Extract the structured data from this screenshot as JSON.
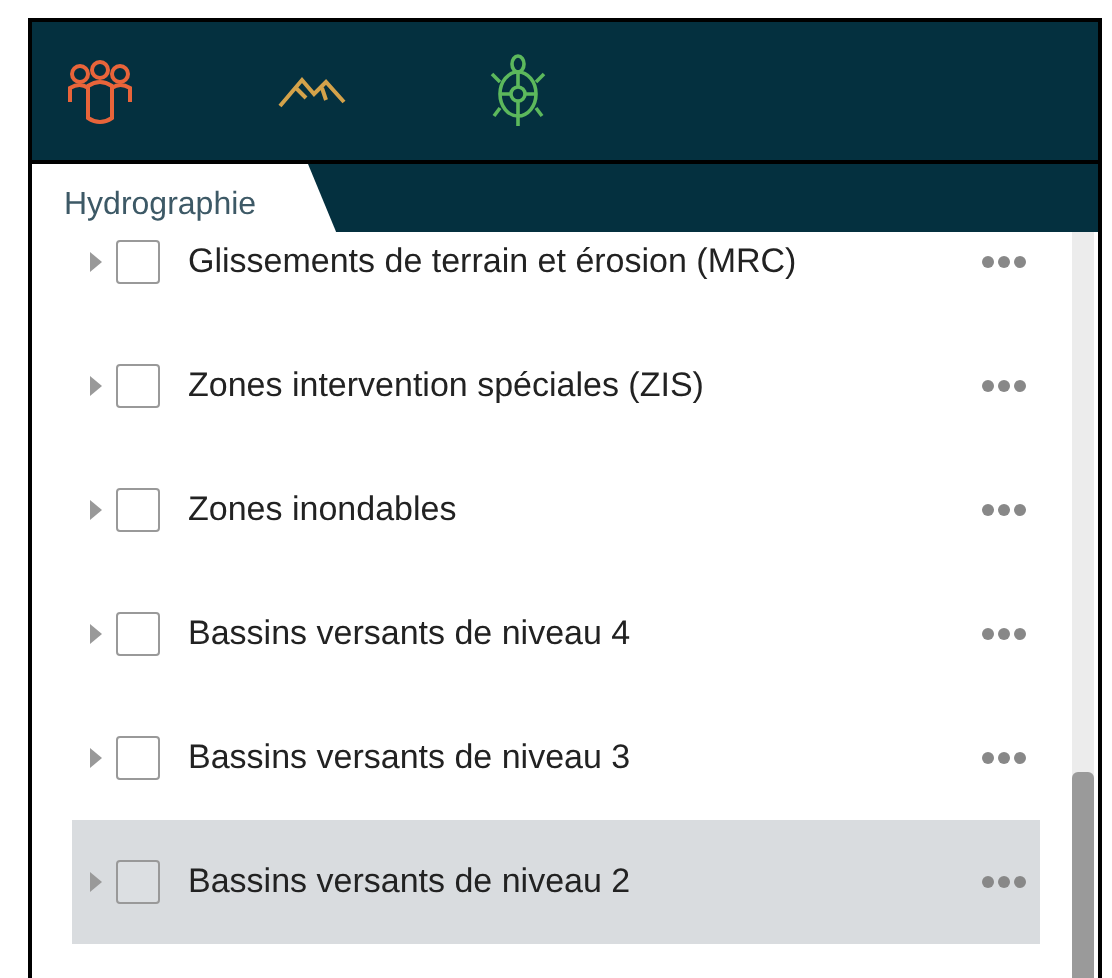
{
  "toolbar": {
    "icons": [
      {
        "kind": "people",
        "color": "#e8643a"
      },
      {
        "kind": "mountains",
        "color": "#d4a24a"
      },
      {
        "kind": "turtle",
        "color": "#5cb85c"
      }
    ]
  },
  "tabs": [
    {
      "label": "Hydrographie",
      "selected": true
    }
  ],
  "layers": [
    {
      "name": "Glissements de terrain et érosion (MRC)",
      "checked": false,
      "selected": false
    },
    {
      "name": "Zones intervention spéciales (ZIS)",
      "checked": false,
      "selected": false
    },
    {
      "name": "Zones inondables",
      "checked": false,
      "selected": false
    },
    {
      "name": "Bassins versants de niveau 4",
      "checked": false,
      "selected": false
    },
    {
      "name": "Bassins versants de niveau 3",
      "checked": false,
      "selected": false
    },
    {
      "name": "Bassins versants de niveau 2",
      "checked": false,
      "selected": true
    }
  ]
}
